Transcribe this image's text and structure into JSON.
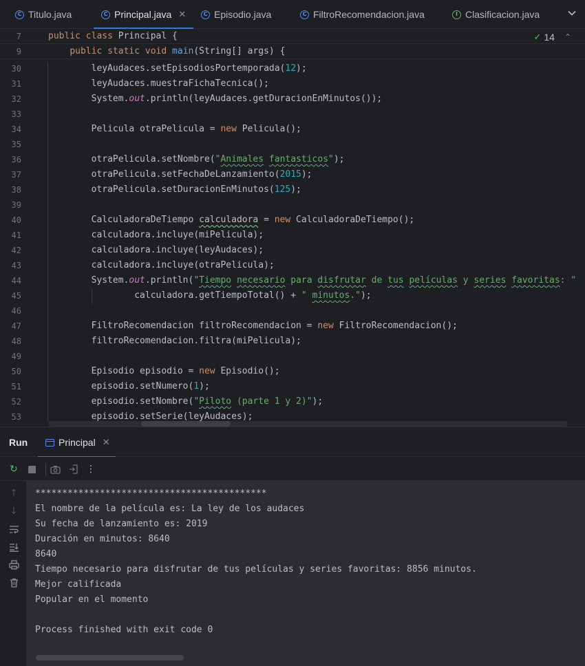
{
  "tabs": [
    {
      "label": "Titulo.java",
      "icon": "class-icon",
      "active": false
    },
    {
      "label": "Principal.java",
      "icon": "class-icon",
      "active": true
    },
    {
      "label": "Episodio.java",
      "icon": "class-icon",
      "active": false
    },
    {
      "label": "FiltroRecomendacion.java",
      "icon": "class-icon",
      "active": false
    },
    {
      "label": "Clasificacion.java",
      "icon": "interface-icon",
      "active": false
    }
  ],
  "editor": {
    "inspection_count": "14",
    "sticky": [
      {
        "ln": "7",
        "tokens": [
          [
            "kw",
            "public "
          ],
          [
            "kw",
            "class "
          ],
          [
            "",
            "Principal {"
          ]
        ]
      },
      {
        "ln": "9",
        "tokens": [
          [
            "",
            "    "
          ],
          [
            "kw",
            "public "
          ],
          [
            "kw",
            "static "
          ],
          [
            "kw",
            "void "
          ],
          [
            "fn",
            "main"
          ],
          [
            "",
            "(String[] args) {"
          ]
        ]
      }
    ],
    "lines": [
      {
        "ln": "30",
        "tokens": [
          [
            "",
            "        leyAudaces.setEpisodiosPortemporada("
          ],
          [
            "num",
            "12"
          ],
          [
            "",
            ");"
          ]
        ]
      },
      {
        "ln": "31",
        "tokens": [
          [
            "",
            "        leyAudaces.muestraFichaTecnica();"
          ]
        ]
      },
      {
        "ln": "32",
        "tokens": [
          [
            "",
            "        System."
          ],
          [
            "stat",
            "out"
          ],
          [
            "",
            ".println(leyAudaces.getDuracionEnMinutos());"
          ]
        ]
      },
      {
        "ln": "33",
        "tokens": []
      },
      {
        "ln": "34",
        "tokens": [
          [
            "",
            "        Pelicula otraPelicula = "
          ],
          [
            "kw",
            "new "
          ],
          [
            "",
            "Pelicula();"
          ]
        ]
      },
      {
        "ln": "35",
        "tokens": []
      },
      {
        "ln": "36",
        "tokens": [
          [
            "",
            "        otraPelicula.setNombre("
          ],
          [
            "str",
            "\""
          ],
          [
            "str squig",
            "Animales"
          ],
          [
            "str",
            " "
          ],
          [
            "str squig",
            "fantasticos"
          ],
          [
            "str",
            "\""
          ],
          [
            "",
            ");"
          ]
        ]
      },
      {
        "ln": "37",
        "tokens": [
          [
            "",
            "        otraPelicula.setFechaDeLanzamiento("
          ],
          [
            "num",
            "2015"
          ],
          [
            "",
            ");"
          ]
        ]
      },
      {
        "ln": "38",
        "tokens": [
          [
            "",
            "        otraPelicula.setDuracionEnMinutos("
          ],
          [
            "num",
            "125"
          ],
          [
            "",
            ");"
          ]
        ]
      },
      {
        "ln": "39",
        "tokens": []
      },
      {
        "ln": "40",
        "tokens": [
          [
            "",
            "        CalculadoraDeTiempo "
          ],
          [
            "squig-plain",
            "calculadora"
          ],
          [
            "",
            " = "
          ],
          [
            "kw",
            "new "
          ],
          [
            "",
            "CalculadoraDeTiempo();"
          ]
        ]
      },
      {
        "ln": "41",
        "tokens": [
          [
            "",
            "        calculadora.incluye(miPelicula);"
          ]
        ]
      },
      {
        "ln": "42",
        "tokens": [
          [
            "",
            "        calculadora.incluye(leyAudaces);"
          ]
        ]
      },
      {
        "ln": "43",
        "tokens": [
          [
            "",
            "        calculadora.incluye(otraPelicula);"
          ]
        ]
      },
      {
        "ln": "44",
        "tokens": [
          [
            "",
            "        System."
          ],
          [
            "stat",
            "out"
          ],
          [
            "",
            ".println("
          ],
          [
            "str",
            "\""
          ],
          [
            "str squig",
            "Tiempo"
          ],
          [
            "str",
            " "
          ],
          [
            "str squig",
            "necesario"
          ],
          [
            "str",
            " para "
          ],
          [
            "str squig",
            "disfrutar"
          ],
          [
            "str",
            " de "
          ],
          [
            "str squig",
            "tus"
          ],
          [
            "str",
            " "
          ],
          [
            "str squig",
            "películas"
          ],
          [
            "str",
            " y "
          ],
          [
            "str squig",
            "series"
          ],
          [
            "str",
            " "
          ],
          [
            "str squig",
            "favoritas"
          ],
          [
            "str",
            ": \""
          ]
        ]
      },
      {
        "ln": "45",
        "tokens": [
          [
            "",
            "                calculadora.getTiempoTotal() + "
          ],
          [
            "str",
            "\" "
          ],
          [
            "str squig",
            "minutos"
          ],
          [
            "str",
            ".\""
          ],
          [
            "",
            ");"
          ]
        ]
      },
      {
        "ln": "46",
        "tokens": []
      },
      {
        "ln": "47",
        "tokens": [
          [
            "",
            "        FiltroRecomendacion filtroRecomendacion = "
          ],
          [
            "kw",
            "new "
          ],
          [
            "",
            "FiltroRecomendacion();"
          ]
        ]
      },
      {
        "ln": "48",
        "tokens": [
          [
            "",
            "        filtroRecomendacion.filtra(miPelicula);"
          ]
        ]
      },
      {
        "ln": "49",
        "tokens": []
      },
      {
        "ln": "50",
        "tokens": [
          [
            "",
            "        Episodio episodio = "
          ],
          [
            "kw",
            "new "
          ],
          [
            "",
            "Episodio();"
          ]
        ]
      },
      {
        "ln": "51",
        "tokens": [
          [
            "",
            "        episodio.setNumero("
          ],
          [
            "num",
            "1"
          ],
          [
            "",
            ");"
          ]
        ]
      },
      {
        "ln": "52",
        "tokens": [
          [
            "",
            "        episodio.setNombre("
          ],
          [
            "str",
            "\""
          ],
          [
            "str squig",
            "Piloto"
          ],
          [
            "str",
            " (parte 1 y 2)\""
          ],
          [
            "",
            ");"
          ]
        ]
      },
      {
        "ln": "53",
        "tokens": [
          [
            "",
            "        episodio.setSerie(leyAudaces);"
          ]
        ]
      }
    ]
  },
  "run": {
    "label": "Run",
    "tab_label": "Principal",
    "output": [
      "*******************************************",
      "El nombre de la película es: La ley de los audaces",
      "Su fecha de lanzamiento es: 2019",
      "Duración en minutos: 8640",
      "8640",
      "Tiempo necesario para disfrutar de tus películas y series favoritas: 8856 minutos.",
      "Mejor calificada",
      "Popular en el momento",
      "",
      "Process finished with exit code 0"
    ]
  },
  "colors": {
    "accent": "#3574f0",
    "keyword": "#cf8e6d",
    "string": "#6aab73",
    "number": "#2aacb8",
    "method": "#56a8f5",
    "static_field": "#c77dbb"
  }
}
